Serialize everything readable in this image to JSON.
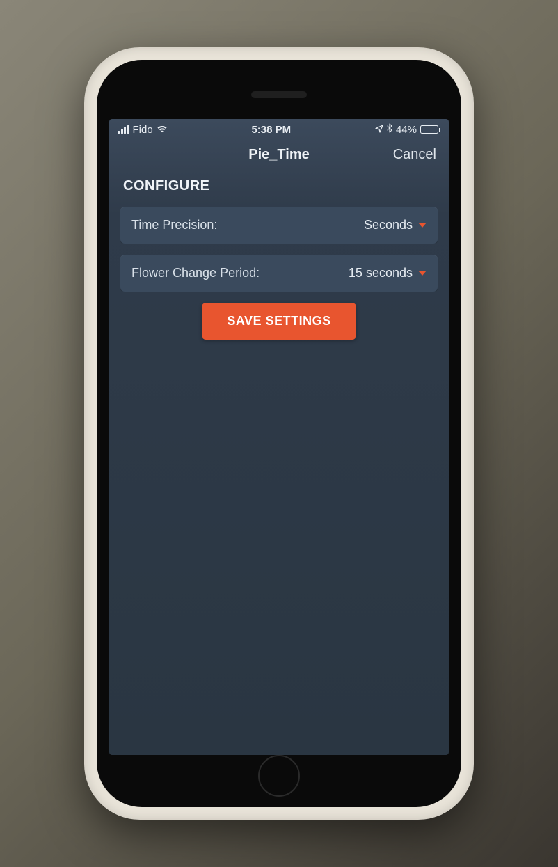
{
  "status_bar": {
    "carrier": "Fido",
    "time": "5:38 PM",
    "battery_percent": "44%"
  },
  "nav": {
    "title": "Pie_Time",
    "cancel": "Cancel"
  },
  "section": {
    "title": "CONFIGURE"
  },
  "settings": {
    "time_precision": {
      "label": "Time Precision:",
      "value": "Seconds"
    },
    "flower_change_period": {
      "label": "Flower Change Period:",
      "value": "15 seconds"
    }
  },
  "save_button": "SAVE SETTINGS",
  "colors": {
    "accent": "#e8552f",
    "panel": "#3a4a5d",
    "text": "#e8edf2"
  }
}
